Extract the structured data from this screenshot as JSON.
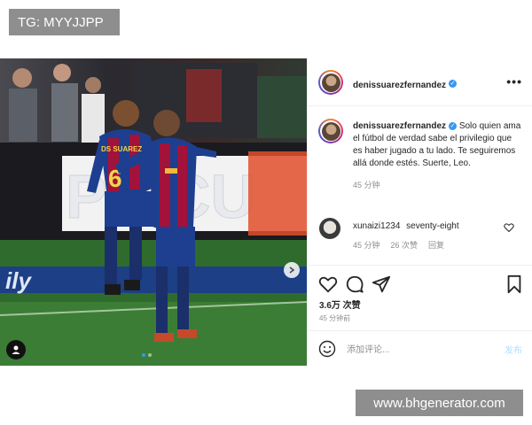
{
  "watermarks": {
    "top": "TG: MYYJJPP",
    "bottom": "www.bhgenerator.com"
  },
  "media": {
    "sponsor_text": "PS CU",
    "ad_text": "ily",
    "jersey_name": "DS SUAREZ",
    "jersey_number": "6",
    "next_icon": "chevron-right-icon",
    "tag_icon": "user-tag-icon",
    "carousel_count": 2
  },
  "post": {
    "username": "denissuarezfernandez",
    "verified_icon": "verified-badge-icon",
    "more_icon": "more-dots-icon",
    "caption": "Solo quien ama el fútbol de verdad sabe el privilegio que es haber jugado a tu lado. Te seguiremos allá donde estés. Suerte, Leo.",
    "caption_time": "45 分钟"
  },
  "comment": {
    "username": "xunaizi1234",
    "text": "seventy-eight",
    "time": "45 分钟",
    "likes": "26 次赞",
    "reply": "回复"
  },
  "actions": {
    "like_icon": "heart-icon",
    "comment_icon": "comment-bubble-icon",
    "share_icon": "paper-plane-icon",
    "save_icon": "bookmark-icon"
  },
  "stats": {
    "likes": "3.6万 次赞",
    "time": "45 分钟前"
  },
  "comment_box": {
    "emoji_icon": "emoji-icon",
    "placeholder": "添加评论...",
    "post_label": "发布"
  },
  "colors": {
    "accent": "#3897f0",
    "post_disabled": "#b2dffc",
    "barca_blue": "#1e3f8f",
    "barca_red": "#a3123a"
  }
}
